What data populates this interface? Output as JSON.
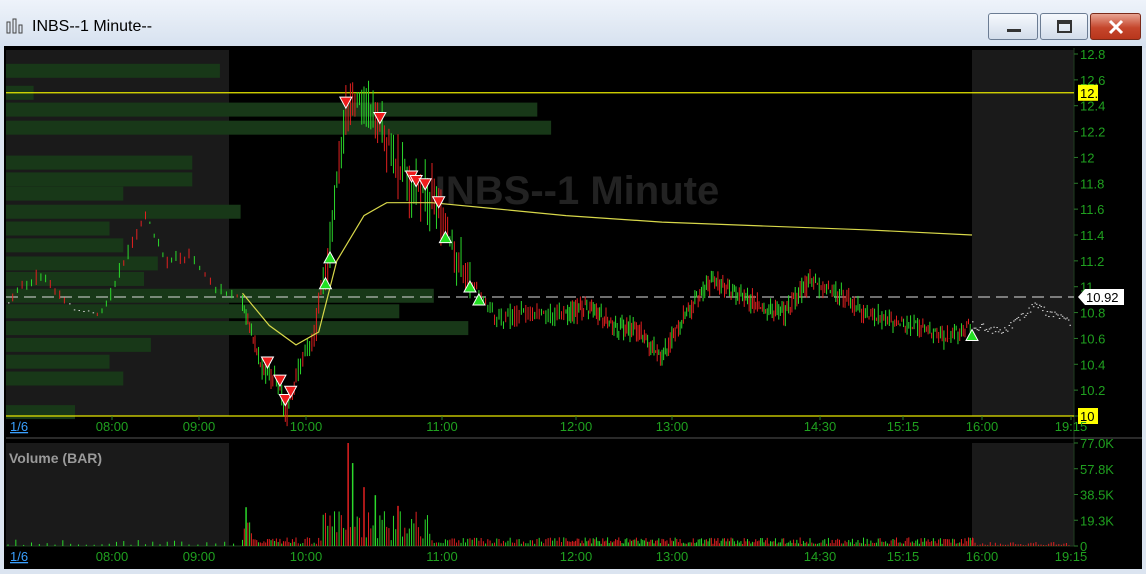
{
  "window": {
    "title": "INBS--1 Minute--",
    "icon": "bar-chart-app-icon",
    "buttons": [
      "minimize-icon",
      "maximize-icon",
      "close-icon"
    ]
  },
  "chart_data": [
    {
      "type": "candlestick",
      "title": "INBS--1 Minute",
      "symbol": "INBS",
      "interval": "1 Minute",
      "date_label": "1/6",
      "x_tick_labels": [
        "08:00",
        "09:00",
        "10:00",
        "11:00",
        "12:00",
        "13:00",
        "14:30",
        "15:15",
        "16:00",
        "19:15"
      ],
      "y_tick_labels": [
        "12.8",
        "12.6",
        "12.4",
        "12.2",
        "12",
        "11.8",
        "11.6",
        "11.4",
        "11.2",
        "11",
        "10.8",
        "10.6",
        "10.4",
        "10.2",
        "10"
      ],
      "ylim": [
        10,
        12.8
      ],
      "price_labels": [
        {
          "label": "12.5",
          "value": 12.5,
          "style": "horizontal-line"
        },
        {
          "label": "10",
          "value": 10,
          "style": "horizontal-line"
        },
        {
          "label": "10.92",
          "value": 10.92,
          "style": "last-price-dashed"
        }
      ],
      "sessions": {
        "premarket_end": "09:30",
        "regular_close": "16:00"
      },
      "volume_profile": {
        "price_levels": [
          12.67,
          12.5,
          12.37,
          12.23,
          11.96,
          11.83,
          11.72,
          11.58,
          11.45,
          11.32,
          11.18,
          11.06,
          10.93,
          10.81,
          10.68,
          10.55,
          10.42,
          10.29,
          10.03
        ],
        "relative_volume": [
          0.31,
          0.04,
          0.77,
          0.79,
          0.27,
          0.27,
          0.17,
          0.34,
          0.15,
          0.17,
          0.22,
          0.2,
          0.62,
          0.57,
          0.67,
          0.21,
          0.15,
          0.17,
          0.1
        ]
      },
      "series": [
        {
          "kind": "price",
          "points": [
            [
              "07:00",
              10.9
            ],
            [
              "07:20",
              11.1
            ],
            [
              "07:40",
              10.85
            ],
            [
              "08:00",
              10.8
            ],
            [
              "08:15",
              11.2
            ],
            [
              "08:30",
              11.55
            ],
            [
              "08:45",
              11.2
            ],
            [
              "09:00",
              11.25
            ],
            [
              "09:15",
              11.0
            ],
            [
              "09:28",
              10.92
            ],
            [
              "09:32",
              10.8
            ],
            [
              "09:40",
              10.4
            ],
            [
              "09:50",
              10.25
            ],
            [
              "09:55",
              10.0
            ],
            [
              "10:02",
              10.4
            ],
            [
              "10:08",
              10.6
            ],
            [
              "10:15",
              11.3
            ],
            [
              "10:22",
              12.35
            ],
            [
              "10:30",
              12.45
            ],
            [
              "10:38",
              12.2
            ],
            [
              "10:45",
              11.95
            ],
            [
              "10:52",
              11.75
            ],
            [
              "11:00",
              11.7
            ],
            [
              "11:05",
              11.5
            ],
            [
              "11:12",
              11.2
            ],
            [
              "11:20",
              11.0
            ],
            [
              "11:30",
              10.75
            ],
            [
              "11:45",
              10.8
            ],
            [
              "12:00",
              10.78
            ],
            [
              "12:15",
              10.85
            ],
            [
              "12:30",
              10.7
            ],
            [
              "12:45",
              10.65
            ],
            [
              "13:00",
              10.45
            ],
            [
              "13:15",
              10.8
            ],
            [
              "13:30",
              11.05
            ],
            [
              "13:45",
              10.95
            ],
            [
              "14:00",
              10.85
            ],
            [
              "14:15",
              10.8
            ],
            [
              "14:30",
              11.05
            ],
            [
              "14:45",
              10.95
            ],
            [
              "15:00",
              10.8
            ],
            [
              "15:15",
              10.75
            ],
            [
              "15:30",
              10.7
            ],
            [
              "15:45",
              10.62
            ],
            [
              "16:00",
              10.7
            ],
            [
              "17:00",
              10.65
            ],
            [
              "18:00",
              10.85
            ],
            [
              "19:15",
              10.72
            ]
          ]
        },
        {
          "kind": "vwap",
          "points": [
            [
              "09:30",
              10.95
            ],
            [
              "09:45",
              10.7
            ],
            [
              "10:00",
              10.55
            ],
            [
              "10:10",
              10.65
            ],
            [
              "10:18",
              11.2
            ],
            [
              "10:30",
              11.55
            ],
            [
              "10:40",
              11.65
            ],
            [
              "11:00",
              11.65
            ],
            [
              "11:30",
              11.6
            ],
            [
              "12:00",
              11.55
            ],
            [
              "13:00",
              11.5
            ],
            [
              "14:00",
              11.47
            ],
            [
              "15:00",
              11.44
            ],
            [
              "16:00",
              11.4
            ]
          ]
        }
      ],
      "signals": {
        "sell": [
          "09:44",
          "09:51",
          "09:54",
          "09:57",
          "10:22",
          "10:37",
          "10:51",
          "10:53",
          "10:57",
          "11:03"
        ],
        "buy": [
          "10:13",
          "10:15",
          "11:06",
          "11:17",
          "11:21",
          "16:00"
        ]
      }
    },
    {
      "type": "bar",
      "title": "Volume (BAR)",
      "date_label": "1/6",
      "x_tick_labels": [
        "08:00",
        "09:00",
        "10:00",
        "11:00",
        "12:00",
        "13:00",
        "14:30",
        "15:15",
        "16:00",
        "19:15"
      ],
      "y_tick_labels": [
        "77.0K",
        "57.8K",
        "38.5K",
        "19.3K",
        "0"
      ],
      "ylim": [
        0,
        77000
      ],
      "notable_bars": [
        [
          "09:32",
          29000
        ],
        [
          "10:23",
          77000
        ],
        [
          "10:25",
          62000
        ],
        [
          "10:30",
          44000
        ],
        [
          "10:35",
          38000
        ],
        [
          "10:45",
          30000
        ]
      ]
    }
  ]
}
